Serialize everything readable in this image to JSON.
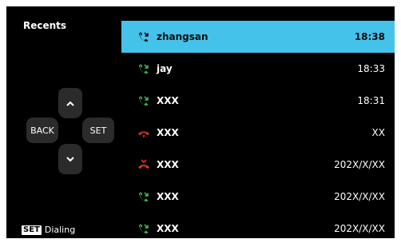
{
  "header": {
    "title": "Recents"
  },
  "dpad": {
    "back_label": "BACK",
    "set_label": "SET"
  },
  "footer": {
    "badge": "SET",
    "hint": "Dialing"
  },
  "calls": [
    {
      "name": "zhangsan",
      "time": "18:38",
      "type": "outgoing",
      "selected": true
    },
    {
      "name": "jay",
      "time": "18:33",
      "type": "outgoing"
    },
    {
      "name": "XXX",
      "time": "18:31",
      "type": "outgoing"
    },
    {
      "name": "XXX",
      "time": "XX",
      "type": "missed"
    },
    {
      "name": "XXX",
      "time": "202X/X/XX",
      "type": "rejected"
    },
    {
      "name": "XXX",
      "time": "202X/X/XX",
      "type": "outgoing"
    },
    {
      "name": "XXX",
      "time": "202X/X/XX",
      "type": "outgoing"
    }
  ],
  "colors": {
    "selected_bg": "#45c2ea",
    "call_green": "#3fb54a",
    "call_red": "#e0332c"
  }
}
